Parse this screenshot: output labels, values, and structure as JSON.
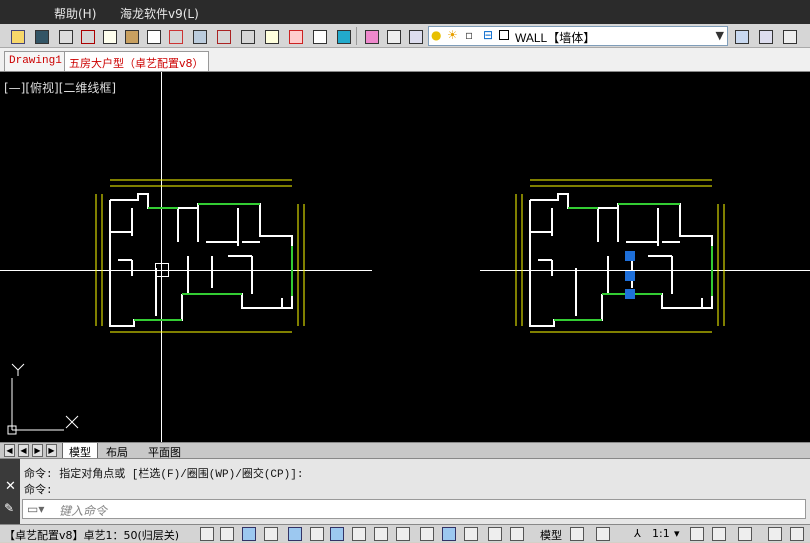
{
  "menubar": {
    "items": [
      "帮助(H)",
      "海龙软件v9(L)"
    ]
  },
  "toolbar": {
    "layer_name": "WALL【墙体】",
    "icons": [
      "new-icon",
      "save-icon",
      "print-icon",
      "cut-icon",
      "copy-icon",
      "paste-icon",
      "match-properties-icon",
      "undo-icon",
      "redo-icon",
      "pan-icon",
      "zoom-icon",
      "zoom-window-icon",
      "zoom-previous-icon",
      "properties-icon",
      "design-center-icon",
      "tool-palettes-icon",
      "sheet-set-icon",
      "markup-icon",
      "calculator-icon"
    ]
  },
  "doc_tabs": {
    "drawing1": "Drawing1",
    "active": "五房大户型（卓艺配置v8）"
  },
  "viewport": {
    "label": "[—][俯视][二维线框]",
    "ucs_x": "X",
    "ucs_y": "Y"
  },
  "layout_tabs": [
    "模型",
    "布局",
    "平面图"
  ],
  "command": {
    "line1": "命令: 指定对角点或 [栏选(F)/圈围(WP)/圈交(CP)]:",
    "line2": "命令:",
    "placeholder": "键入命令"
  },
  "status": {
    "workspace": "【卓艺配置v8】卓艺1：50(归层关)",
    "model": "模型",
    "scale": "1:1"
  },
  "colors": {
    "canvas": "#000000",
    "wall": "#ffffff",
    "dimension": "#ffff00",
    "window": "#33cc33",
    "grip": "#1e6fd9"
  }
}
